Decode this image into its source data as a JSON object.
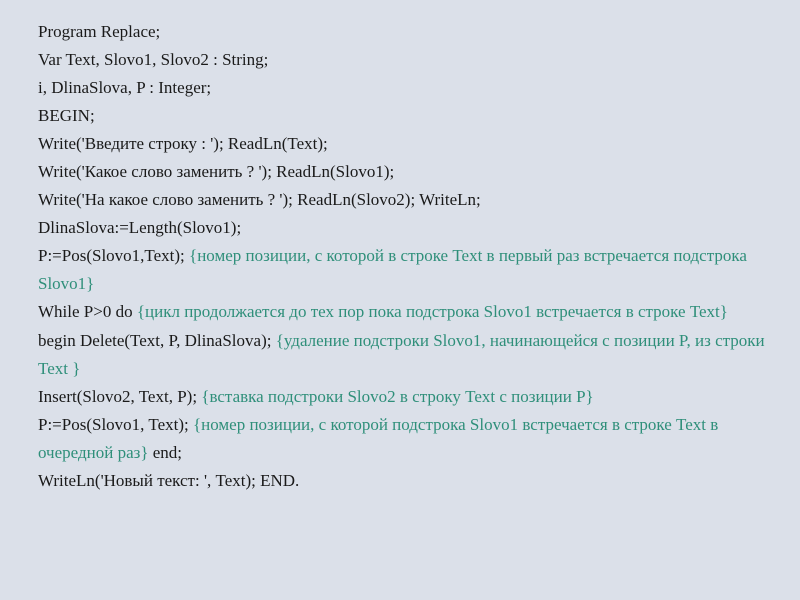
{
  "lines": [
    {
      "segments": [
        {
          "cls": "code",
          "t": "Program Replace;"
        }
      ]
    },
    {
      "segments": [
        {
          "cls": "code",
          "t": "Var Text, Slovo1, Slovo2 : String;"
        }
      ]
    },
    {
      "segments": [
        {
          "cls": "code",
          "t": "i, DlinaSlova, P : Integer;"
        }
      ]
    },
    {
      "segments": [
        {
          "cls": "code",
          "t": "BEGIN;"
        }
      ]
    },
    {
      "segments": [
        {
          "cls": "code",
          "t": "Write('Введите строку : '); ReadLn(Text);"
        }
      ]
    },
    {
      "segments": [
        {
          "cls": "code",
          "t": "Write('Какое слово заменить ? '); ReadLn(Slovo1);"
        }
      ]
    },
    {
      "segments": [
        {
          "cls": "code",
          "t": "Write('На какое слово заменить ? '); ReadLn(Slovo2);  WriteLn;"
        }
      ]
    },
    {
      "segments": [
        {
          "cls": "code",
          "t": "DlinaSlova:=Length(Slovo1);"
        }
      ]
    },
    {
      "segments": [
        {
          "cls": "code",
          "t": "P:=Pos(Slovo1,Text); "
        },
        {
          "cls": "comment",
          "t": "{номер позиции, с которой в строке Text в первый раз встречается подстрока Slovo1}"
        }
      ]
    },
    {
      "segments": [
        {
          "cls": "code",
          "t": "While P>0 do "
        },
        {
          "cls": "comment",
          "t": "{цикл продолжается до тех пор пока подстрока Slovo1 встречается в строке Text}"
        }
      ]
    },
    {
      "segments": [
        {
          "cls": "code",
          "t": "begin Delete(Text, P, DlinaSlova); "
        },
        {
          "cls": "comment",
          "t": "{удаление подстроки Slovo1, начинающейся с позиции P, из строки Text  }"
        }
      ]
    },
    {
      "segments": [
        {
          "cls": "code",
          "t": "Insert(Slovo2, Text, P);  "
        },
        {
          "cls": "comment",
          "t": "{вставка подстроки Slovo2 в  строку Text с позиции P}"
        }
      ]
    },
    {
      "segments": [
        {
          "cls": "code",
          "t": "P:=Pos(Slovo1, Text); "
        },
        {
          "cls": "comment",
          "t": "{номер позиции, с которой подстрока Slovo1 встречается в строке Text в очередной раз}"
        },
        {
          "cls": "code",
          "t": " end;"
        }
      ]
    },
    {
      "segments": [
        {
          "cls": "code",
          "t": "WriteLn('Новый текст: ', Text);    END."
        }
      ]
    }
  ]
}
